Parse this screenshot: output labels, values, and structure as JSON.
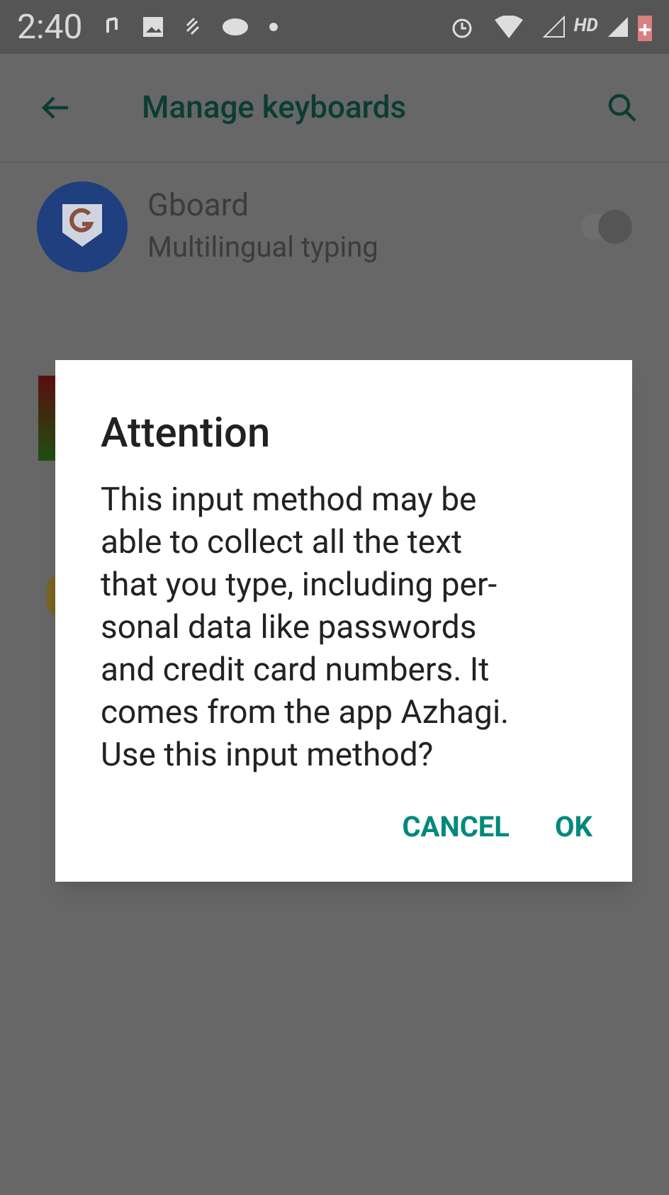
{
  "status_bar": {
    "time": "2:40",
    "network": "HD"
  },
  "toolbar": {
    "title": "Manage keyboards"
  },
  "keyboards": [
    {
      "name": "Gboard",
      "subtitle": "Multilingual typing",
      "on": true
    }
  ],
  "dialog": {
    "title": "Attention",
    "body_lines": [
      "This input method may be",
      "able to collect all the text",
      "that you type, including per-",
      "sonal data like passwords",
      "and credit card numbers. It",
      "comes from the app Azhagi.",
      "Use this input method?"
    ],
    "buttons": [
      "CANCEL",
      "OK"
    ]
  }
}
